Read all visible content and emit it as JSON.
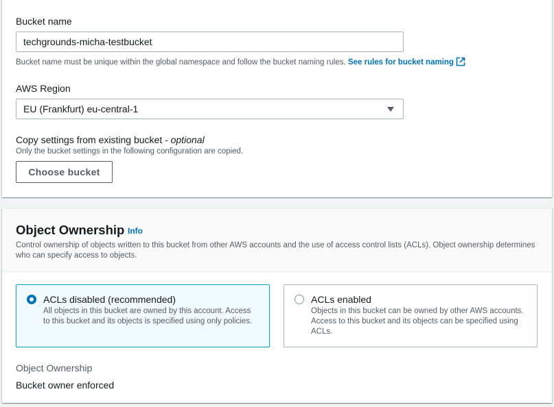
{
  "general": {
    "bucket_name_label": "Bucket name",
    "bucket_name_value": "techgrounds-micha-testbucket",
    "bucket_name_hint": "Bucket name must be unique within the global namespace and follow the bucket naming rules.",
    "bucket_name_rules_link": "See rules for bucket naming",
    "region_label": "AWS Region",
    "region_value": "EU (Frankfurt) eu-central-1",
    "copy_label": "Copy settings from existing bucket - ",
    "copy_label_optional": "optional",
    "copy_hint": "Only the bucket settings in the following configuration are copied.",
    "choose_bucket_button": "Choose bucket"
  },
  "ownership": {
    "title": "Object Ownership",
    "info_link": "Info",
    "description": "Control ownership of objects written to this bucket from other AWS accounts and the use of access control lists (ACLs). Object ownership determines who can specify access to objects.",
    "options": [
      {
        "label": "ACLs disabled (recommended)",
        "description": "All objects in this bucket are owned by this account. Access to this bucket and its objects is specified using only policies.",
        "selected": true
      },
      {
        "label": "ACLs enabled",
        "description": "Objects in this bucket can be owned by other AWS accounts. Access to this bucket and its objects can be specified using ACLs.",
        "selected": false
      }
    ],
    "result_label": "Object Ownership",
    "result_value": "Bucket owner enforced"
  },
  "colors": {
    "link": "#0073bb",
    "selected_tile_bg": "#f1faff",
    "selected_tile_border": "#00a1c9"
  },
  "icons": {
    "external_link": "external-link-icon",
    "dropdown_caret": "caret-down-icon"
  }
}
